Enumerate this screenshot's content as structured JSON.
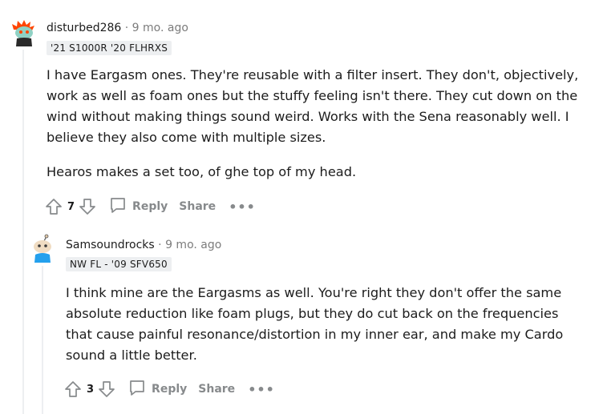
{
  "comments": [
    {
      "author": "disturbed286",
      "separator": "·",
      "time": "9 mo. ago",
      "flair": "'21 S1000R '20 FLHRXS",
      "paragraphs": [
        "I have Eargasm ones. They're reusable with a filter insert. They don't, objectively, work as well as foam ones but the stuffy feeling isn't there. They cut down on the wind without making things sound weird. Works with the Sena reasonably well. I believe they also come with multiple sizes.",
        "Hearos makes a set too, of ghe top of my head."
      ],
      "votes": "7",
      "reply_label": "Reply",
      "share_label": "Share",
      "more_label": "•••"
    },
    {
      "author": "Samsoundrocks",
      "separator": "·",
      "time": "9 mo. ago",
      "flair": "NW FL - '09 SFV650",
      "paragraphs": [
        "I think mine are the Eargasms as well. You're right they don't offer the same absolute reduction like foam plugs, but they do cut back on the frequencies that cause painful resonance/distortion in my inner ear, and make my Cardo sound a little better."
      ],
      "votes": "3",
      "reply_label": "Reply",
      "share_label": "Share",
      "more_label": "•••"
    }
  ],
  "colors": {
    "meta_gray": "#7c7c7c",
    "action_gray": "#878a8c",
    "flair_bg": "#edeff1",
    "text": "#1c1c1c",
    "avatar1_orange": "#ff4500",
    "avatar2_blue": "#0079d3"
  },
  "icons": {
    "avatar1": "snoo-avatar-icon",
    "avatar2": "snoo-avatar-icon",
    "upvote": "upvote-arrow-icon",
    "downvote": "downvote-arrow-icon",
    "reply": "comment-bubble-icon",
    "more": "more-options-icon"
  }
}
